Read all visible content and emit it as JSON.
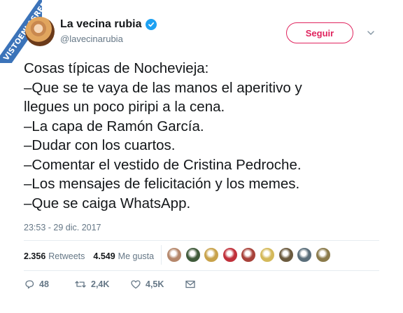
{
  "watermark": "VISTOENLASREDES",
  "author": {
    "display_name": "La vecina rubia",
    "handle": "@lavecinarubia",
    "verified_icon": "verified-badge-icon"
  },
  "follow_button": "Seguir",
  "tweet_lines": [
    "Cosas típicas de Nochevieja:",
    "–Que se te vaya de las manos el aperitivo y",
    "llegues un poco piripi a la cena.",
    "–La capa de Ramón García.",
    "–Dudar con los cuartos.",
    "–Comentar el vestido de Cristina Pedroche.",
    "–Los mensajes de felicitación y los memes.",
    "–Que se caiga WhatsApp."
  ],
  "timestamp": "23:53 - 29 dic. 2017",
  "stats": {
    "retweets_count": "2.356",
    "retweets_label": "Retweets",
    "likes_count": "4.549",
    "likes_label": "Me gusta"
  },
  "liker_avatar_colors": [
    "#b5876b",
    "#3f5a3a",
    "#c8a24a",
    "#c0303a",
    "#a8423a",
    "#d4b95a",
    "#6b5a3e",
    "#5a6e7a",
    "#8a7a4a"
  ],
  "actions": {
    "reply_count": "48",
    "retweet_count": "2,4K",
    "like_count": "4,5K"
  },
  "colors": {
    "accent_red": "#e0245e",
    "verified_blue": "#1da1f2",
    "muted": "#657786",
    "watermark_blue": "#3b73b9"
  }
}
